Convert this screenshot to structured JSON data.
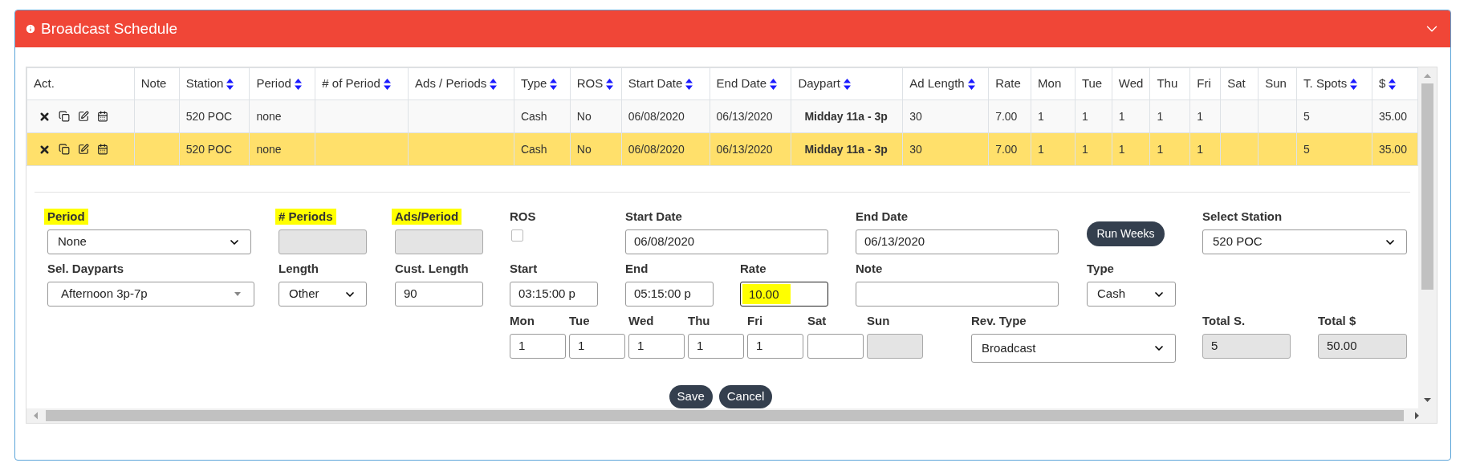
{
  "panel": {
    "title": "Broadcast Schedule"
  },
  "table": {
    "columns": [
      {
        "label": "Act.",
        "sortable": false
      },
      {
        "label": "Note",
        "sortable": false
      },
      {
        "label": "Station",
        "sortable": true
      },
      {
        "label": "Period",
        "sortable": true
      },
      {
        "label": "# of Period",
        "sortable": true
      },
      {
        "label": "Ads / Periods",
        "sortable": true
      },
      {
        "label": "Type",
        "sortable": true
      },
      {
        "label": "ROS",
        "sortable": true
      },
      {
        "label": "Start Date",
        "sortable": true
      },
      {
        "label": "End Date",
        "sortable": true
      },
      {
        "label": "Daypart",
        "sortable": true
      },
      {
        "label": "Ad Length",
        "sortable": true
      },
      {
        "label": "Rate",
        "sortable": false
      },
      {
        "label": "Mon",
        "sortable": false
      },
      {
        "label": "Tue",
        "sortable": false
      },
      {
        "label": "Wed",
        "sortable": false
      },
      {
        "label": "Thu",
        "sortable": false
      },
      {
        "label": "Fri",
        "sortable": false
      },
      {
        "label": "Sat",
        "sortable": false
      },
      {
        "label": "Sun",
        "sortable": false
      },
      {
        "label": "T. Spots",
        "sortable": true
      },
      {
        "label": "$",
        "sortable": true
      }
    ],
    "rows": [
      {
        "selected": false,
        "cells": [
          "",
          "",
          "520 POC",
          "none",
          "",
          "",
          "Cash",
          "No",
          "06/08/2020",
          "06/13/2020",
          "Midday 11a - 3p",
          "30",
          "7.00",
          "1",
          "1",
          "1",
          "1",
          "1",
          "",
          "",
          "5",
          "35.00"
        ]
      },
      {
        "selected": true,
        "cells": [
          "",
          "",
          "520 POC",
          "none",
          "",
          "",
          "Cash",
          "No",
          "06/08/2020",
          "06/13/2020",
          "Midday 11a - 3p",
          "30",
          "7.00",
          "1",
          "1",
          "1",
          "1",
          "1",
          "",
          "",
          "5",
          "35.00"
        ]
      }
    ]
  },
  "form": {
    "fields": [
      {
        "kind": "select",
        "label": "Period",
        "label_highlighted": true,
        "value": "None"
      },
      {
        "kind": "input",
        "label": "# Periods",
        "label_highlighted": true,
        "disabled": true
      },
      {
        "kind": "input",
        "label": "Ads/Period",
        "label_highlighted": true,
        "disabled": true
      },
      {
        "kind": "checkbox",
        "label": "ROS",
        "checked": false
      },
      {
        "kind": "input",
        "label": "Start Date",
        "value": "06/08/2020",
        "disabled": false
      },
      {
        "kind": "input",
        "label": "End Date",
        "value": "06/13/2020",
        "disabled": false
      },
      {
        "kind": "button",
        "label": "Run Weeks"
      },
      {
        "kind": "select",
        "label": "Select Station",
        "value": "520 POC"
      },
      {
        "kind": "combo",
        "label": "Sel. Dayparts",
        "value": "Afternoon 3p-7p"
      },
      {
        "kind": "select",
        "label": "Length",
        "value": "Other"
      },
      {
        "kind": "input",
        "label": "Cust. Length",
        "value": "90",
        "disabled": false
      },
      {
        "kind": "input",
        "label": "Start",
        "value": "03:15:00 p",
        "disabled": false
      },
      {
        "kind": "input",
        "label": "End",
        "value": "05:15:00 p",
        "disabled": false
      },
      {
        "kind": "input",
        "label": "Rate",
        "value": "10.00",
        "disabled": false,
        "value_highlighted": true
      },
      {
        "kind": "input",
        "label": "Note",
        "disabled": false
      },
      {
        "kind": "select",
        "label": "Type",
        "value": "Cash"
      },
      {
        "kind": "input",
        "label": "Mon",
        "value": "1",
        "disabled": false
      },
      {
        "kind": "input",
        "label": "Tue",
        "value": "1",
        "disabled": false
      },
      {
        "kind": "input",
        "label": "Wed",
        "value": "1",
        "disabled": false
      },
      {
        "kind": "input",
        "label": "Thu",
        "value": "1",
        "disabled": false
      },
      {
        "kind": "input",
        "label": "Fri",
        "value": "1",
        "disabled": false
      },
      {
        "kind": "input",
        "label": "Sat",
        "disabled": false
      },
      {
        "kind": "input",
        "label": "Sun",
        "disabled": true
      },
      {
        "kind": "select",
        "label": "Rev. Type",
        "value": "Broadcast"
      },
      {
        "kind": "input",
        "label": "Total S.",
        "value": "5",
        "disabled": true
      },
      {
        "kind": "input",
        "label": "Total $",
        "value": "50.00",
        "disabled": true
      }
    ],
    "actions": [
      "Save",
      "Cancel"
    ]
  }
}
